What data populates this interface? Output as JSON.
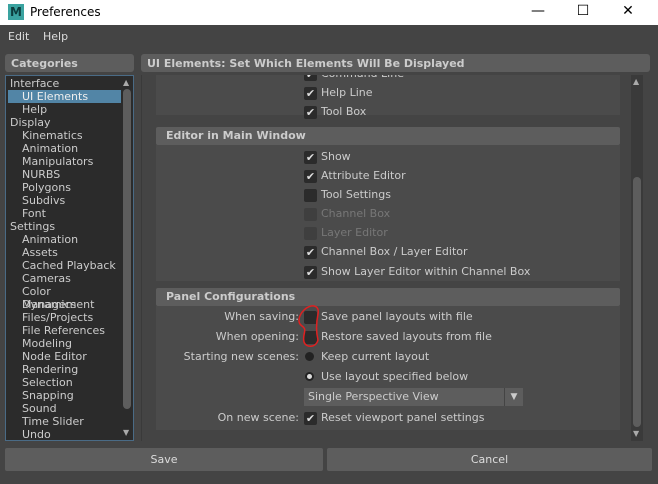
{
  "window": {
    "title": "Preferences",
    "logo": "M",
    "minimize": "—",
    "maximize": "☐",
    "close": "✕"
  },
  "menu": [
    "Edit",
    "Help"
  ],
  "categories": {
    "title": "Categories",
    "selected": "UI Elements",
    "items": [
      {
        "label": "Interface",
        "indent": 0
      },
      {
        "label": "UI Elements",
        "indent": 1
      },
      {
        "label": "Help",
        "indent": 1
      },
      {
        "label": "Display",
        "indent": 0
      },
      {
        "label": "Kinematics",
        "indent": 1
      },
      {
        "label": "Animation",
        "indent": 1
      },
      {
        "label": "Manipulators",
        "indent": 1
      },
      {
        "label": "NURBS",
        "indent": 1
      },
      {
        "label": "Polygons",
        "indent": 1
      },
      {
        "label": "Subdivs",
        "indent": 1
      },
      {
        "label": "Font",
        "indent": 1
      },
      {
        "label": "Settings",
        "indent": 0
      },
      {
        "label": "Animation",
        "indent": 1
      },
      {
        "label": "Assets",
        "indent": 1
      },
      {
        "label": "Cached Playback",
        "indent": 1
      },
      {
        "label": "Cameras",
        "indent": 1
      },
      {
        "label": "Color Management",
        "indent": 1
      },
      {
        "label": "Dynamics",
        "indent": 1
      },
      {
        "label": "Files/Projects",
        "indent": 1
      },
      {
        "label": "File References",
        "indent": 1
      },
      {
        "label": "Modeling",
        "indent": 1
      },
      {
        "label": "Node Editor",
        "indent": 1
      },
      {
        "label": "Rendering",
        "indent": 1
      },
      {
        "label": "Selection",
        "indent": 1
      },
      {
        "label": "Snapping",
        "indent": 1
      },
      {
        "label": "Sound",
        "indent": 1
      },
      {
        "label": "Time Slider",
        "indent": 1
      },
      {
        "label": "Undo",
        "indent": 1
      }
    ]
  },
  "panel": {
    "title": "UI Elements: Set Which Elements Will Be Displayed",
    "top_items": [
      {
        "label": "Command Line",
        "checked": true
      },
      {
        "label": "Help Line",
        "checked": true
      },
      {
        "label": "Tool Box",
        "checked": true
      }
    ],
    "editor_section": {
      "title": "Editor in Main Window",
      "items": [
        {
          "label": "Show",
          "checked": true,
          "enabled": true
        },
        {
          "label": "Attribute Editor",
          "checked": true,
          "enabled": true
        },
        {
          "label": "Tool Settings",
          "checked": false,
          "enabled": true
        },
        {
          "label": "Channel Box",
          "checked": false,
          "enabled": false
        },
        {
          "label": "Layer Editor",
          "checked": false,
          "enabled": false
        },
        {
          "label": "Channel Box / Layer Editor",
          "checked": true,
          "enabled": true
        },
        {
          "label": "Show Layer Editor within Channel Box",
          "checked": true,
          "enabled": true
        }
      ]
    },
    "panel_section": {
      "title": "Panel Configurations",
      "when_saving": {
        "label": "When saving:",
        "option": "Save panel layouts with file",
        "checked": false
      },
      "when_opening": {
        "label": "When opening:",
        "option": "Restore saved layouts from file",
        "checked": false
      },
      "starting": {
        "label": "Starting new scenes:",
        "options": [
          "Keep current layout",
          "Use layout specified below"
        ],
        "selected": 1
      },
      "layout_dropdown": "Single Perspective View",
      "on_new_scene": {
        "label": "On new scene:",
        "option": "Reset viewport panel settings",
        "checked": true
      }
    }
  },
  "buttons": {
    "save": "Save",
    "cancel": "Cancel"
  },
  "annotation_color": "#e02020"
}
